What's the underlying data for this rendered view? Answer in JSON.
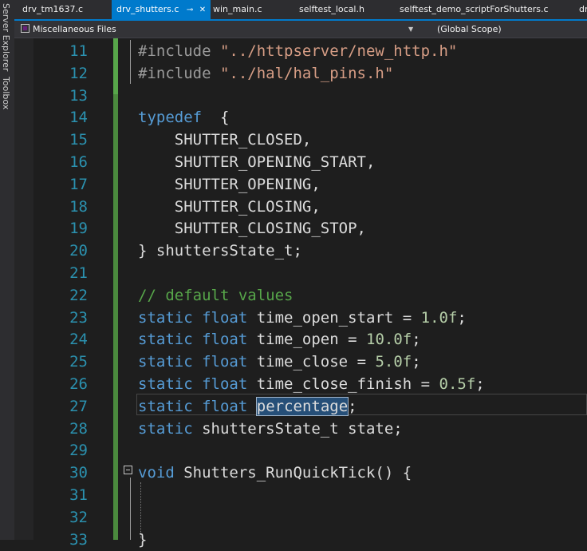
{
  "sidebar": {
    "server_explorer": "Server Explorer",
    "toolbox": "Toolbox"
  },
  "tabs": [
    {
      "label": "drv_tm1637.c",
      "active": false
    },
    {
      "label": "drv_shutters.c",
      "active": true
    },
    {
      "label": "win_main.c",
      "active": false
    },
    {
      "label": "selftest_local.h",
      "active": false
    },
    {
      "label": "selftest_demo_scriptForShutters.c",
      "active": false
    },
    {
      "label": "dr",
      "active": false
    }
  ],
  "icons": {
    "pin": "pin-icon",
    "close": "close-icon",
    "dropdown": "chevron-down-icon",
    "project": "project-icon",
    "fold": "collapse-icon"
  },
  "navbar": {
    "project": "Miscellaneous Files",
    "scope": "(Global Scope)"
  },
  "colors": {
    "accent": "#007acc",
    "keyword": "#569cd6",
    "string": "#d69d85",
    "comment": "#57a64a",
    "number": "#b5cea8",
    "line_number": "#2b91af",
    "selection": "#264f78"
  },
  "editor": {
    "lines": [
      {
        "num": "11",
        "tokens": [
          {
            "t": "pp",
            "v": "#include "
          },
          {
            "t": "str",
            "v": "\"../httpserver/new_http.h\""
          }
        ]
      },
      {
        "num": "12",
        "tokens": [
          {
            "t": "pp",
            "v": "#include "
          },
          {
            "t": "str",
            "v": "\"../hal/hal_pins.h\""
          }
        ]
      },
      {
        "num": "13",
        "tokens": []
      },
      {
        "num": "14",
        "tokens": [
          {
            "t": "kw",
            "v": "typedef"
          },
          {
            "t": "ident",
            "v": "  {"
          }
        ]
      },
      {
        "num": "15",
        "tokens": [
          {
            "t": "ident",
            "v": "    SHUTTER_CLOSED,"
          }
        ]
      },
      {
        "num": "16",
        "tokens": [
          {
            "t": "ident",
            "v": "    SHUTTER_OPENING_START,"
          }
        ]
      },
      {
        "num": "17",
        "tokens": [
          {
            "t": "ident",
            "v": "    SHUTTER_OPENING,"
          }
        ]
      },
      {
        "num": "18",
        "tokens": [
          {
            "t": "ident",
            "v": "    SHUTTER_CLOSING,"
          }
        ]
      },
      {
        "num": "19",
        "tokens": [
          {
            "t": "ident",
            "v": "    SHUTTER_CLOSING_STOP,"
          }
        ]
      },
      {
        "num": "20",
        "tokens": [
          {
            "t": "ident",
            "v": "} shuttersState_t;"
          }
        ]
      },
      {
        "num": "21",
        "tokens": []
      },
      {
        "num": "22",
        "tokens": [
          {
            "t": "cmt",
            "v": "// default values"
          }
        ]
      },
      {
        "num": "23",
        "tokens": [
          {
            "t": "kw",
            "v": "static"
          },
          {
            "t": "ident",
            "v": " "
          },
          {
            "t": "kw",
            "v": "float"
          },
          {
            "t": "ident",
            "v": " time_open_start = "
          },
          {
            "t": "num",
            "v": "1.0f"
          },
          {
            "t": "ident",
            "v": ";"
          }
        ]
      },
      {
        "num": "24",
        "tokens": [
          {
            "t": "kw",
            "v": "static"
          },
          {
            "t": "ident",
            "v": " "
          },
          {
            "t": "kw",
            "v": "float"
          },
          {
            "t": "ident",
            "v": " time_open = "
          },
          {
            "t": "num",
            "v": "10.0f"
          },
          {
            "t": "ident",
            "v": ";"
          }
        ]
      },
      {
        "num": "25",
        "tokens": [
          {
            "t": "kw",
            "v": "static"
          },
          {
            "t": "ident",
            "v": " "
          },
          {
            "t": "kw",
            "v": "float"
          },
          {
            "t": "ident",
            "v": " time_close = "
          },
          {
            "t": "num",
            "v": "5.0f"
          },
          {
            "t": "ident",
            "v": ";"
          }
        ]
      },
      {
        "num": "26",
        "tokens": [
          {
            "t": "kw",
            "v": "static"
          },
          {
            "t": "ident",
            "v": " "
          },
          {
            "t": "kw",
            "v": "float"
          },
          {
            "t": "ident",
            "v": " time_close_finish = "
          },
          {
            "t": "num",
            "v": "0.5f"
          },
          {
            "t": "ident",
            "v": ";"
          }
        ]
      },
      {
        "num": "27",
        "tokens": [
          {
            "t": "kw",
            "v": "static"
          },
          {
            "t": "ident",
            "v": " "
          },
          {
            "t": "kw",
            "v": "float"
          },
          {
            "t": "ident",
            "v": " "
          },
          {
            "t": "sel",
            "v": "percentage"
          },
          {
            "t": "ident",
            "v": ";"
          }
        ]
      },
      {
        "num": "28",
        "tokens": [
          {
            "t": "kw",
            "v": "static"
          },
          {
            "t": "ident",
            "v": " shuttersState_t state;"
          }
        ]
      },
      {
        "num": "29",
        "tokens": []
      },
      {
        "num": "30",
        "tokens": [
          {
            "t": "kw",
            "v": "void"
          },
          {
            "t": "ident",
            "v": " Shutters_RunQuickTick() {"
          }
        ]
      },
      {
        "num": "31",
        "tokens": []
      },
      {
        "num": "32",
        "tokens": []
      },
      {
        "num": "33",
        "tokens": [
          {
            "t": "ident",
            "v": "}"
          }
        ]
      }
    ]
  }
}
